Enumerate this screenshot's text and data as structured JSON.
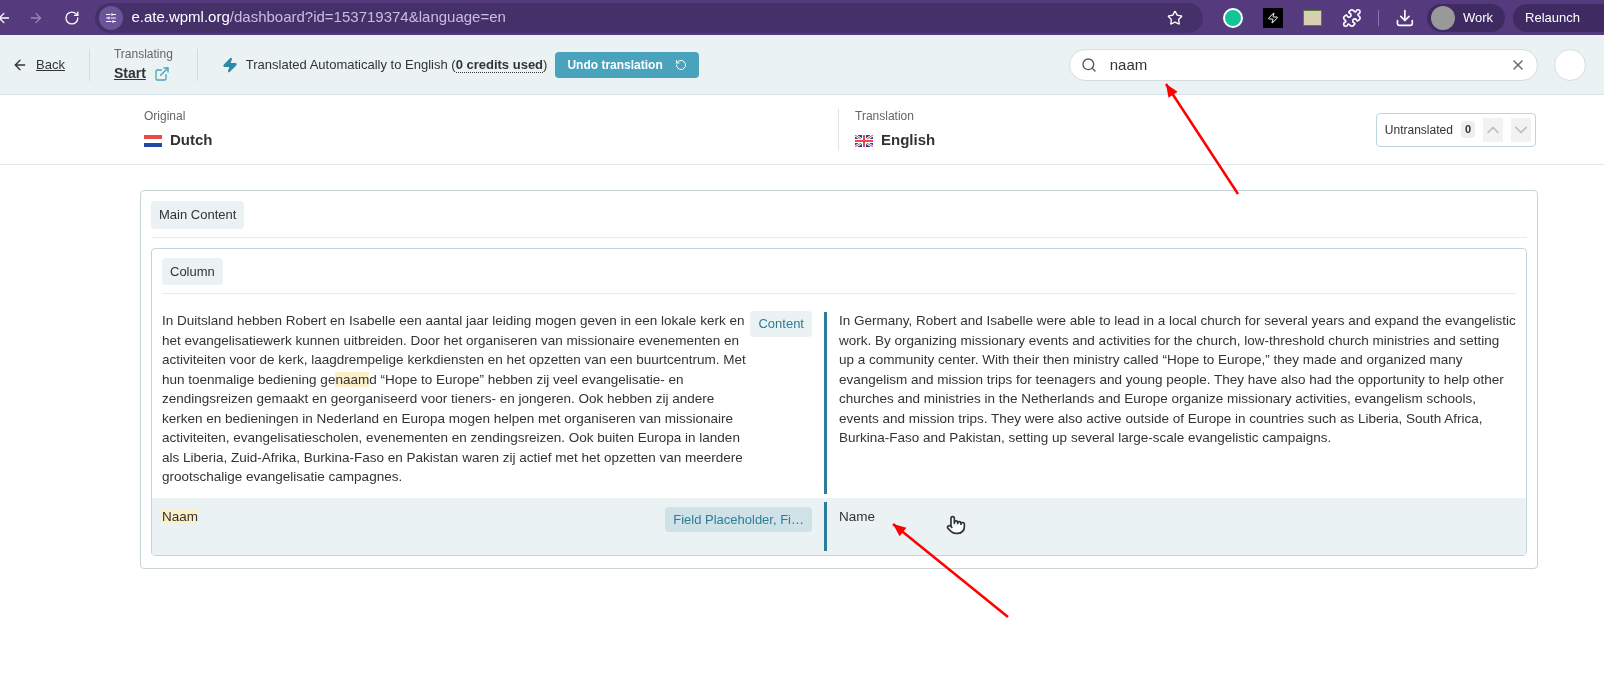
{
  "browser": {
    "url_host": "e.ate.wpml.org",
    "url_path": "/dashboard?id=153719374&language=en",
    "profile": "Work",
    "relaunch": "Relaunch"
  },
  "header": {
    "back": "Back",
    "translating_label": "Translating",
    "translating_link": "Start",
    "status_before": "Translated Automatically to English (",
    "credits": "0 credits used",
    "status_after": ")",
    "undo_button": "Undo translation",
    "search": {
      "value": "naam"
    }
  },
  "languages": {
    "original_label": "Original",
    "original": "Dutch",
    "translation_label": "Translation",
    "translation": "English",
    "untranslated_label": "Untranslated",
    "untranslated_count": "0"
  },
  "main_tag": "Main Content",
  "column_tag": "Column",
  "rows": [
    {
      "selected": false,
      "tag": "Content",
      "source": [
        {
          "text": "In Duitsland hebben Robert en Isabelle een aantal jaar leiding mogen geven in een lokale kerk en het evangelisatiewerk kunnen uitbreiden. Door het organiseren van missionaire evenementen en activiteiten voor de kerk, laagdrempelige kerkdiensten en het opzetten van een buurtcentrum. Met hun toenmalige bediening ge",
          "highlight": false
        },
        {
          "text": "naam",
          "highlight": true
        },
        {
          "text": "d “Hope to Europe” hebben zij veel evangelisatie- en zendingsreizen gemaakt en georganiseerd voor tieners- en jongeren. Ook hebben zij andere kerken en bedieningen in Nederland en Europa mogen helpen met organiseren van missionaire activiteiten, evangelisatiescholen, evenementen en zendingsreizen. Ook buiten Europa in landen als Liberia, Zuid-Afrika, Burkina-Faso en Pakistan waren zij actief met het opzetten van meerdere grootschalige evangelisatie campagnes.",
          "highlight": false
        }
      ],
      "target": "In Germany, Robert and Isabelle were able to lead in a local church for several years and expand the evangelistic work. By organizing missionary events and activities for the church, low-threshold church ministries and setting up a community center. With their then ministry called “Hope to Europe,” they made and organized many evangelism and mission trips for teenagers and young people. They have also had the opportunity to help other churches and ministries in the Netherlands and Europe organize missionary activities, evangelism schools, events and mission trips. They were also active outside of Europe in countries such as Liberia, South Africa, Burkina-Faso and Pakistan, setting up several large-scale evangelistic campaigns."
    },
    {
      "selected": true,
      "tag": "Field Placeholder, Fi…",
      "source": [
        {
          "text": "Naam",
          "highlight": true
        }
      ],
      "target": "Name"
    }
  ]
}
